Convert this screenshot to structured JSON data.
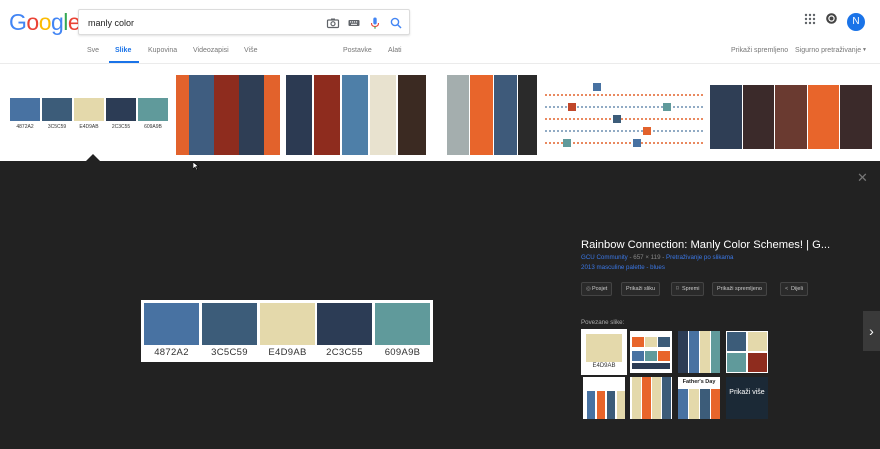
{
  "logo": {
    "text": "Google"
  },
  "search": {
    "value": "manly color"
  },
  "header": {
    "avatar": "N",
    "colors": {
      "logo": [
        "#4285f4",
        "#ea4335",
        "#fbbc05",
        "#4285f4",
        "#34a853",
        "#ea4335"
      ]
    }
  },
  "tabs": {
    "items": [
      "Sve",
      "Slike",
      "Kupovina",
      "Videozapisi",
      "Više",
      "Postavke",
      "Alati"
    ],
    "active": "Slike",
    "show_saved": "Prikaži spremljeno",
    "safe_search": "Sigurno pretraživanje"
  },
  "strip": {
    "first_thumb_labels": [
      "4872A2",
      "3C5C59",
      "E4D9AB",
      "2C3C55",
      "609A9B"
    ]
  },
  "palette": {
    "colors": [
      "#4872a2",
      "#3c5c79",
      "#e4d9ab",
      "#2c3c55",
      "#609a9b"
    ],
    "labels": [
      "4872A2",
      "3C5C59",
      "E4D9AB",
      "2C3C55",
      "609A9B"
    ]
  },
  "viewer": {
    "title": "Rainbow Connection: Manly Color Schemes! | G...",
    "source": "GCU Community",
    "dimensions": "657 × 119",
    "reverse_search": "Pretraživanje po slikama",
    "description": "2013 masculine palette - blues",
    "actions": [
      "Posjet",
      "Prikaži sliku",
      "Spremi",
      "Prikaži spremljeno",
      "Dijeli"
    ],
    "related_label": "Povezane slike:",
    "related_first_label": "E4D9AB",
    "related_fathers_day": "Father's Day",
    "more_label": "Prikaži više"
  }
}
